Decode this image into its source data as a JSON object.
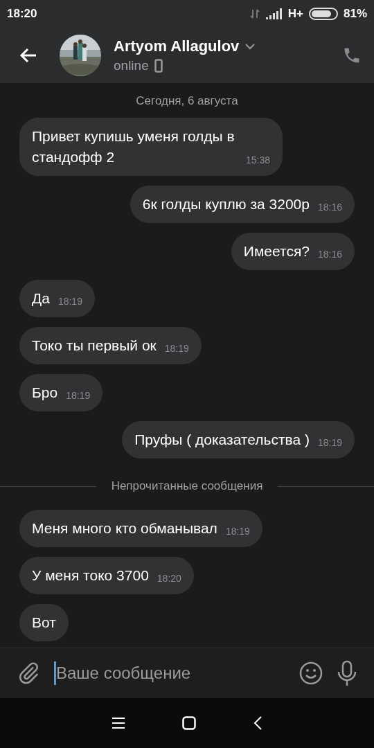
{
  "status_bar": {
    "time": "18:20",
    "network": "H+",
    "battery": "81%"
  },
  "header": {
    "name": "Artyom Allagulov",
    "status": "online"
  },
  "messages": [
    {
      "kind": "date",
      "text": "Сегодня, 6 августа"
    },
    {
      "kind": "in",
      "text": "Привет купишь уменя голды в стандофф 2",
      "time": "15:38"
    },
    {
      "kind": "out",
      "text": "6к голды куплю за 3200р",
      "time": "18:16"
    },
    {
      "kind": "out",
      "text": "Имеется?",
      "time": "18:16"
    },
    {
      "kind": "in",
      "text": "Да",
      "time": "18:19"
    },
    {
      "kind": "in",
      "text": "Токо ты первый ок",
      "time": "18:19"
    },
    {
      "kind": "in",
      "text": "Бро",
      "time": "18:19"
    },
    {
      "kind": "out",
      "text": "Пруфы ( доказательства )",
      "time": "18:19"
    },
    {
      "kind": "unread",
      "text": "Непрочитанные сообщения"
    },
    {
      "kind": "in",
      "text": "Меня много кто обманывал",
      "time": "18:19"
    },
    {
      "kind": "in",
      "text": "У меня токо 3700",
      "time": "18:20"
    },
    {
      "kind": "in",
      "text": "Вот"
    }
  ],
  "composer": {
    "placeholder": "Ваше сообщение"
  }
}
